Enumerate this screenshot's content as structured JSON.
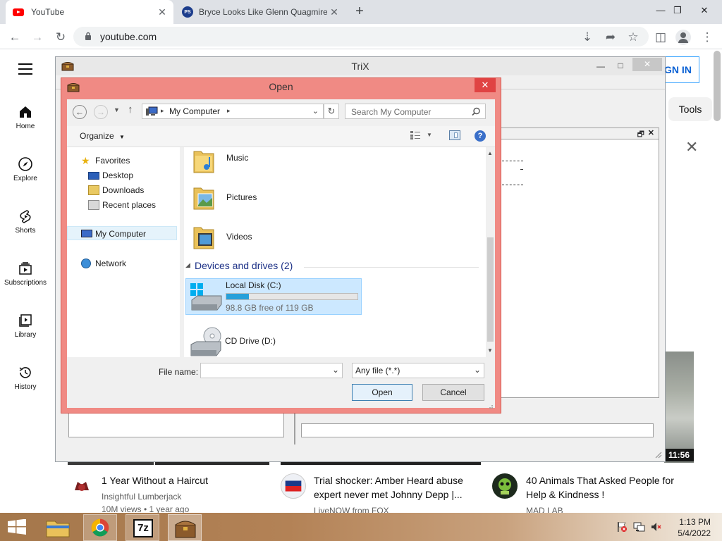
{
  "browser": {
    "tabs": [
      {
        "title": "YouTube",
        "close": "✕"
      },
      {
        "title": "Bryce Looks Like Glenn Quagmire",
        "close": "✕"
      }
    ],
    "new_tab": "+",
    "window_controls": {
      "minimize": "—",
      "restore": "❐",
      "close": "✕"
    },
    "url": "youtube.com"
  },
  "youtube": {
    "nav": [
      {
        "label": "Home",
        "icon": "home-icon"
      },
      {
        "label": "Explore",
        "icon": "compass-icon"
      },
      {
        "label": "Shorts",
        "icon": "shorts-icon"
      },
      {
        "label": "Subscriptions",
        "icon": "subscriptions-icon"
      },
      {
        "label": "Library",
        "icon": "library-icon"
      },
      {
        "label": "History",
        "icon": "history-icon"
      }
    ],
    "sign_in": "GN IN",
    "tools_chip": "Tools",
    "duration": "11:56",
    "videos": [
      {
        "title": "1 Year Without a Haircut",
        "channel": "Insightful Lumberjack",
        "meta": "10M views • 1 year ago"
      },
      {
        "title": "Trial shocker: Amber Heard abuse expert never met Johnny Depp |...",
        "channel": "LiveNOW from FOX",
        "meta": ""
      },
      {
        "title": "40 Animals That Asked People for Help & Kindness !",
        "channel": "MAD LAB",
        "meta": ""
      }
    ]
  },
  "trix": {
    "title": "TriX",
    "controls": {
      "minimize": "—",
      "maximize": "□",
      "close": "✕"
    },
    "subwindow_controls": {
      "restore": "🗗",
      "close": "✕"
    }
  },
  "dialog": {
    "title": "Open",
    "close": "✕",
    "address": "My Computer",
    "search_placeholder": "Search My Computer",
    "organize": "Organize",
    "tree": {
      "favorites": "Favorites",
      "desktop": "Desktop",
      "downloads": "Downloads",
      "recent": "Recent places",
      "my_computer": "My Computer",
      "network": "Network"
    },
    "folders": [
      "Music",
      "Pictures",
      "Videos"
    ],
    "devices_header": "Devices and drives (2)",
    "drives": [
      {
        "name": "Local Disk (C:)",
        "free": "98.8 GB free of 119 GB",
        "used_fraction": 0.17
      },
      {
        "name": "CD Drive (D:)"
      }
    ],
    "file_name_label": "File name:",
    "file_name_value": "",
    "file_type": "Any file (*.*)",
    "open_btn": "Open",
    "cancel_btn": "Cancel"
  },
  "taskbar": {
    "apps": [
      "file-explorer-icon",
      "chrome-icon",
      "7zip-icon",
      "trix-icon"
    ],
    "seven_zip_label": "7z",
    "time": "1:13 PM",
    "date": "5/4/2022"
  },
  "colors": {
    "dialog_frame": "#f08a84",
    "dialog_close": "#e04343",
    "selection": "#cce8ff",
    "link_blue": "#065fd4"
  }
}
